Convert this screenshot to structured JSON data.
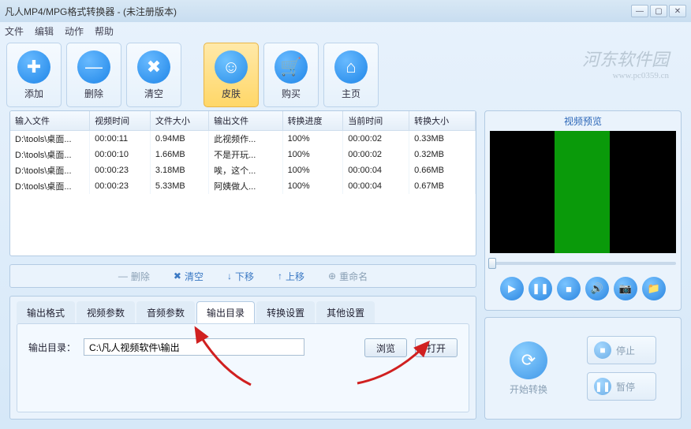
{
  "window": {
    "title": "凡人MP4/MPG格式转换器 - (未注册版本)"
  },
  "menu": {
    "file": "文件",
    "edit": "编辑",
    "action": "动作",
    "help": "帮助"
  },
  "toolbar": {
    "add": "添加",
    "delete": "删除",
    "clear": "清空",
    "skin": "皮肤",
    "buy": "购买",
    "home": "主页"
  },
  "table": {
    "headers": {
      "input": "输入文件",
      "vtime": "视频时间",
      "fsize": "文件大小",
      "output": "输出文件",
      "progress": "转换进度",
      "curtime": "当前时间",
      "convsize": "转换大小"
    },
    "rows": [
      {
        "input": "D:\\tools\\桌面...",
        "vtime": "00:00:11",
        "fsize": "0.94MB",
        "output": "此视频作...",
        "progress": "100%",
        "curtime": "00:00:02",
        "convsize": "0.33MB"
      },
      {
        "input": "D:\\tools\\桌面...",
        "vtime": "00:00:10",
        "fsize": "1.66MB",
        "output": "不是开玩...",
        "progress": "100%",
        "curtime": "00:00:02",
        "convsize": "0.32MB"
      },
      {
        "input": "D:\\tools\\桌面...",
        "vtime": "00:00:23",
        "fsize": "3.18MB",
        "output": "唉，这个...",
        "progress": "100%",
        "curtime": "00:00:04",
        "convsize": "0.66MB"
      },
      {
        "input": "D:\\tools\\桌面...",
        "vtime": "00:00:23",
        "fsize": "5.33MB",
        "output": "阿姨做人...",
        "progress": "100%",
        "curtime": "00:00:04",
        "convsize": "0.67MB"
      }
    ]
  },
  "listActions": {
    "delete": "删除",
    "clear": "清空",
    "down": "下移",
    "up": "上移",
    "rename": "重命名"
  },
  "tabs": {
    "format": "输出格式",
    "video": "视频参数",
    "audio": "音频参数",
    "outdir": "输出目录",
    "convset": "转换设置",
    "other": "其他设置"
  },
  "outdir": {
    "label": "输出目录：",
    "value": "C:\\凡人视频软件\\输出",
    "browse": "浏览",
    "open": "打开"
  },
  "preview": {
    "title": "视频预览"
  },
  "convert": {
    "start_label": "开始转换",
    "stop": "停止",
    "pause": "暂停"
  },
  "watermark": {
    "brand": "河东软件园",
    "url": "www.pc0359.cn"
  }
}
